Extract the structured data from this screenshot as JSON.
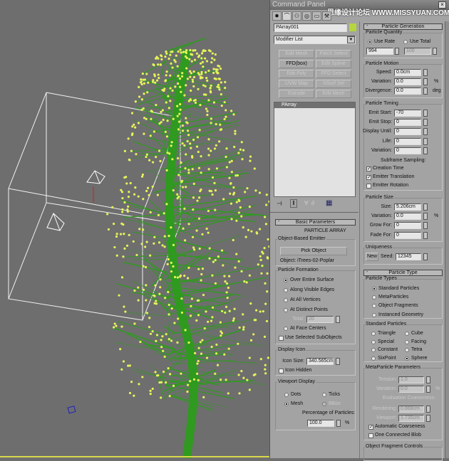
{
  "window": {
    "title": "Command Panel",
    "close": "×",
    "watermark": "思缘设计论坛 WWW.MISSYUAN.COM"
  },
  "tabs": [
    {
      "icon": "create-icon",
      "glyph": "✸"
    },
    {
      "icon": "modify-icon",
      "glyph": "⌒"
    },
    {
      "icon": "hierarchy-icon",
      "glyph": "⚇"
    },
    {
      "icon": "motion-icon",
      "glyph": "◎"
    },
    {
      "icon": "display-icon",
      "glyph": "▭"
    },
    {
      "icon": "utilities-icon",
      "glyph": "⚒"
    }
  ],
  "object": {
    "name": "PArray001",
    "color": "#b5d63c"
  },
  "modifier_list": {
    "value": "Modifier List",
    "arrow": "▼"
  },
  "modifier_buttons": [
    "Edit Mesh",
    "Patch Select",
    "FFD(box)",
    "Edit Spline",
    "Edit Poly",
    "FFD Select",
    "UVW Map",
    "NSurf Sel",
    "Extrude",
    "Edit Mesh"
  ],
  "stack": {
    "items": [
      "PArray"
    ]
  },
  "stack_tools": [
    {
      "icon": "pin-stack-icon",
      "glyph": "⊣"
    },
    {
      "icon": "show-end-result-icon",
      "glyph": "‖"
    },
    {
      "icon": "make-unique-icon",
      "glyph": "∀"
    },
    {
      "icon": "remove-modifier-icon",
      "glyph": "∂"
    },
    {
      "icon": "configure-modifier-sets-icon",
      "glyph": "▦"
    }
  ],
  "basic": {
    "header": "Basic Parameters",
    "title": "PARTICLE ARRAY",
    "emitter_group": "Object-Based Emitter",
    "pick": "Pick Object",
    "object": "Object: iTrees-02-Poplar",
    "formation_group": "Particle Formation",
    "formation": [
      "Over Entire Surface",
      "Along Visible Edges",
      "At All Vertices",
      "At Distinct Points",
      "At Face Centers"
    ],
    "total_label": "Total:",
    "total": "20",
    "use_sub": "Use Selected SubObjects",
    "icon_group": "Display Icon",
    "icon_size_label": "Icon Size:",
    "icon_size": "340.565cm",
    "icon_hidden": "Icon Hidden",
    "vp_group": "Viewport Display",
    "vp": [
      "Dots",
      "Ticks",
      "Mesh",
      "BBox"
    ],
    "pct_label": "Percentage of Particles:",
    "pct": "100.0",
    "pct_unit": "%"
  },
  "gen": {
    "header": "Particle Generation",
    "qty_group": "Particle Quantity",
    "use_rate": "Use Rate",
    "use_total": "Use Total",
    "rate": "994",
    "total": "100",
    "motion_group": "Particle Motion",
    "speed_label": "Speed:",
    "speed": "0.0cm",
    "var_label": "Variation:",
    "var": "0.0",
    "var_unit": "%",
    "div_label": "Divergence:",
    "div": "0.0",
    "div_unit": "deg",
    "timing_group": "Particle Timing",
    "timing": [
      {
        "label": "Emit Start:",
        "value": "-70"
      },
      {
        "label": "Emit Stop:",
        "value": "0"
      },
      {
        "label": "Display Until:",
        "value": "0"
      },
      {
        "label": "Life:",
        "value": "0"
      },
      {
        "label": "Variation:",
        "value": "0"
      }
    ],
    "subframe": "Subframe Sampling:",
    "creation": "Creation Time",
    "translation": "Emitter Translation",
    "rotation": "Emitter Rotation",
    "size_group": "Particle Size",
    "size": [
      {
        "label": "Size:",
        "value": "5.206cm"
      },
      {
        "label": "Variation:",
        "value": "0.0",
        "unit": "%"
      },
      {
        "label": "Grow For:",
        "value": "0"
      },
      {
        "label": "Fade For:",
        "value": "0"
      }
    ],
    "uniq_group": "Uniqueness",
    "new": "New",
    "seed_label": "Seed:",
    "seed": "12345"
  },
  "ptype": {
    "header": "Particle Type",
    "types_group": "Particle Types",
    "types": [
      "Standard Particles",
      "MetaParticles",
      "Object Fragments",
      "Instanced Geometry"
    ],
    "std_group": "Standard Particles",
    "std": [
      "Triangle",
      "Cube",
      "Special",
      "Facing",
      "Constant",
      "Tetra",
      "SixPoint",
      "Sphere"
    ],
    "meta_group": "MetaParticle Parameters",
    "tension_label": "Tension:",
    "tension": "1.0",
    "mvar_label": "Variation:",
    "mvar": "0.0",
    "mvar_unit": "%",
    "eval": "Evaluation Coarseness:",
    "render_label": "Rendering:",
    "render": "0.868cm",
    "vport_label": "Viewport:",
    "vport": "1.735cm",
    "auto": "Automatic Coarseness",
    "blob": "One Connected Blob",
    "frag_group": "Object Fragment Controls"
  },
  "colors": {
    "viewport": "#6e6e6e",
    "branch": "#2f9a1f",
    "particle": "#e6f35a",
    "panel": "#a3a3a3"
  }
}
